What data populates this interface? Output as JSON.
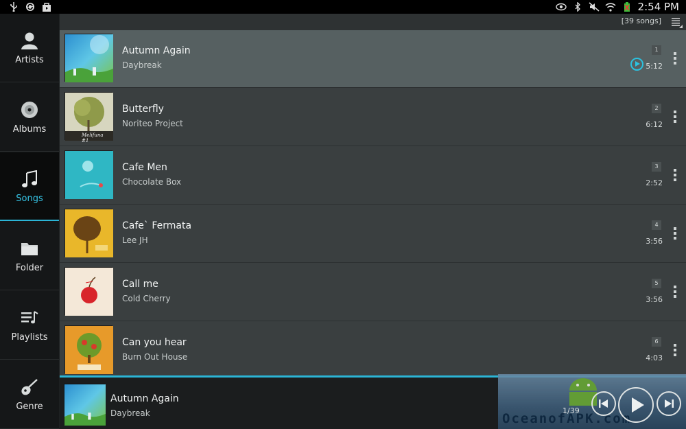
{
  "status_bar": {
    "time": "2:54 PM",
    "left_icons": [
      "usb-icon",
      "sync-icon",
      "shopping-bag-icon"
    ],
    "right_icons": [
      "eye-icon",
      "bluetooth-icon",
      "mute-icon",
      "wifi-icon",
      "battery-icon"
    ]
  },
  "sidebar": {
    "items": [
      {
        "label": "Artists",
        "icon": "artist-icon"
      },
      {
        "label": "Albums",
        "icon": "album-disc-icon"
      },
      {
        "label": "Songs",
        "icon": "music-note-icon",
        "active": true
      },
      {
        "label": "Folder",
        "icon": "folder-icon"
      },
      {
        "label": "Playlists",
        "icon": "playlist-icon"
      },
      {
        "label": "Genre",
        "icon": "guitar-icon"
      }
    ],
    "accent_color": "#2bb5d6"
  },
  "list_header": {
    "song_count": "[39 songs]"
  },
  "songs": [
    {
      "title": "Autumn Again",
      "artist": "Daybreak",
      "track": "1",
      "duration": "5:12",
      "playing": true
    },
    {
      "title": "Butterfly",
      "artist": "Noriteo Project",
      "track": "2",
      "duration": "6:12",
      "cover_text": "Melifuna #1"
    },
    {
      "title": "Cafe Men",
      "artist": "Chocolate Box",
      "track": "3",
      "duration": "2:52"
    },
    {
      "title": "Cafe` Fermata",
      "artist": "Lee JH",
      "track": "4",
      "duration": "3:56"
    },
    {
      "title": "Call me",
      "artist": "Cold Cherry",
      "track": "5",
      "duration": "3:56"
    },
    {
      "title": "Can you hear",
      "artist": "Burn Out House",
      "track": "6",
      "duration": "4:03"
    }
  ],
  "now_playing": {
    "title": "Autumn Again",
    "artist": "Daybreak",
    "counter": "1/39"
  },
  "watermark": {
    "text": "OceanofAPK.com"
  }
}
